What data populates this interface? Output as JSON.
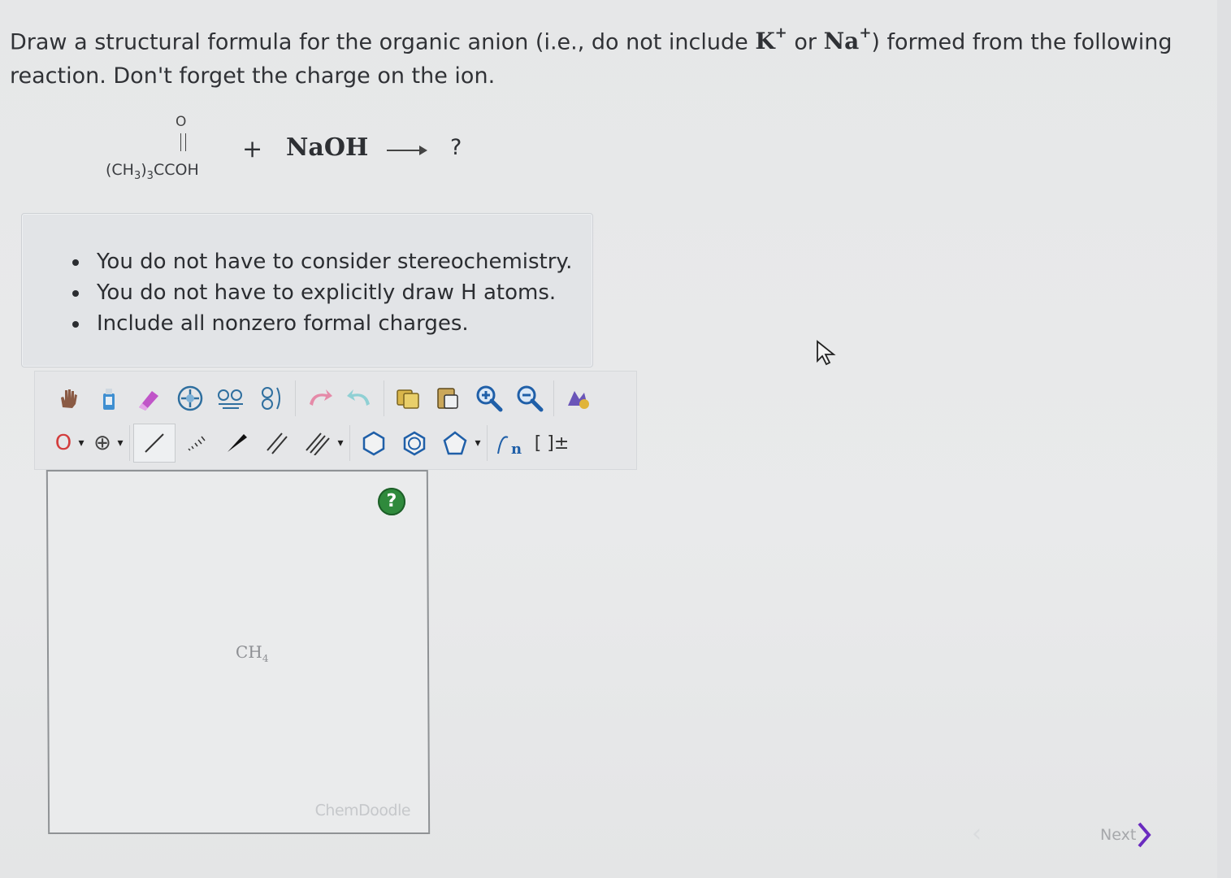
{
  "question": {
    "part1": "Draw a structural formula for the organic anion (i.e., do not include ",
    "ion1_base": "K",
    "ion1_sup": "+",
    "or_text": " or ",
    "ion2_base": "Na",
    "ion2_sup": "+",
    "part2": ") formed from the following reaction. Don't forget the charge on the ion."
  },
  "reaction": {
    "reactant_oxygen": "O",
    "reactant_prefix": "(CH",
    "reactant_sub1": "3",
    "reactant_mid": ")",
    "reactant_sub2": "3",
    "reactant_suffix": "CCOH",
    "plus": "+",
    "reagent": "NaOH",
    "product": "?"
  },
  "instructions": [
    "You do not have to consider stereochemistry.",
    "You do not have to explicitly draw H atoms.",
    "Include all nonzero formal charges."
  ],
  "toolbar": {
    "atom_selector": "O",
    "charge_selector": "⊕",
    "bracket_label": "[ ]±",
    "caret": "▾"
  },
  "canvas": {
    "help_label": "?",
    "placeholder_base": "CH",
    "placeholder_sub": "4",
    "watermark": "ChemDoodle"
  },
  "nav": {
    "next_label": "Next"
  },
  "colors": {
    "help_green": "#2f8a3c",
    "next_chevron": "#6a2bbf",
    "zoom_blue": "#1f5fa8"
  }
}
